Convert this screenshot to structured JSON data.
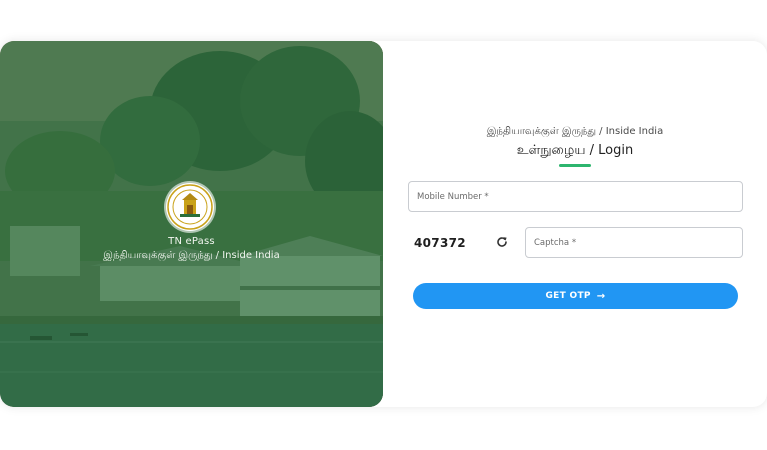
{
  "hero": {
    "title": "TN ePass",
    "subtitle": "இந்தியாவுக்குள் இருந்து / Inside India",
    "emblem_icon": "tamil-nadu-emblem-icon"
  },
  "form": {
    "heading": "இந்தியாவுக்குள் இருந்து / Inside India",
    "title": "உள்நுழைய / Login",
    "mobile_placeholder": "Mobile Number *",
    "captcha_code": "407372",
    "refresh_icon": "refresh-icon",
    "captcha_placeholder": "Captcha *",
    "submit_label": "GET OTP",
    "submit_icon": "arrow-right-icon"
  },
  "colors": {
    "accent": "#2196f3",
    "underline": "#2db56e",
    "hero_overlay": "#1e6e3c"
  }
}
